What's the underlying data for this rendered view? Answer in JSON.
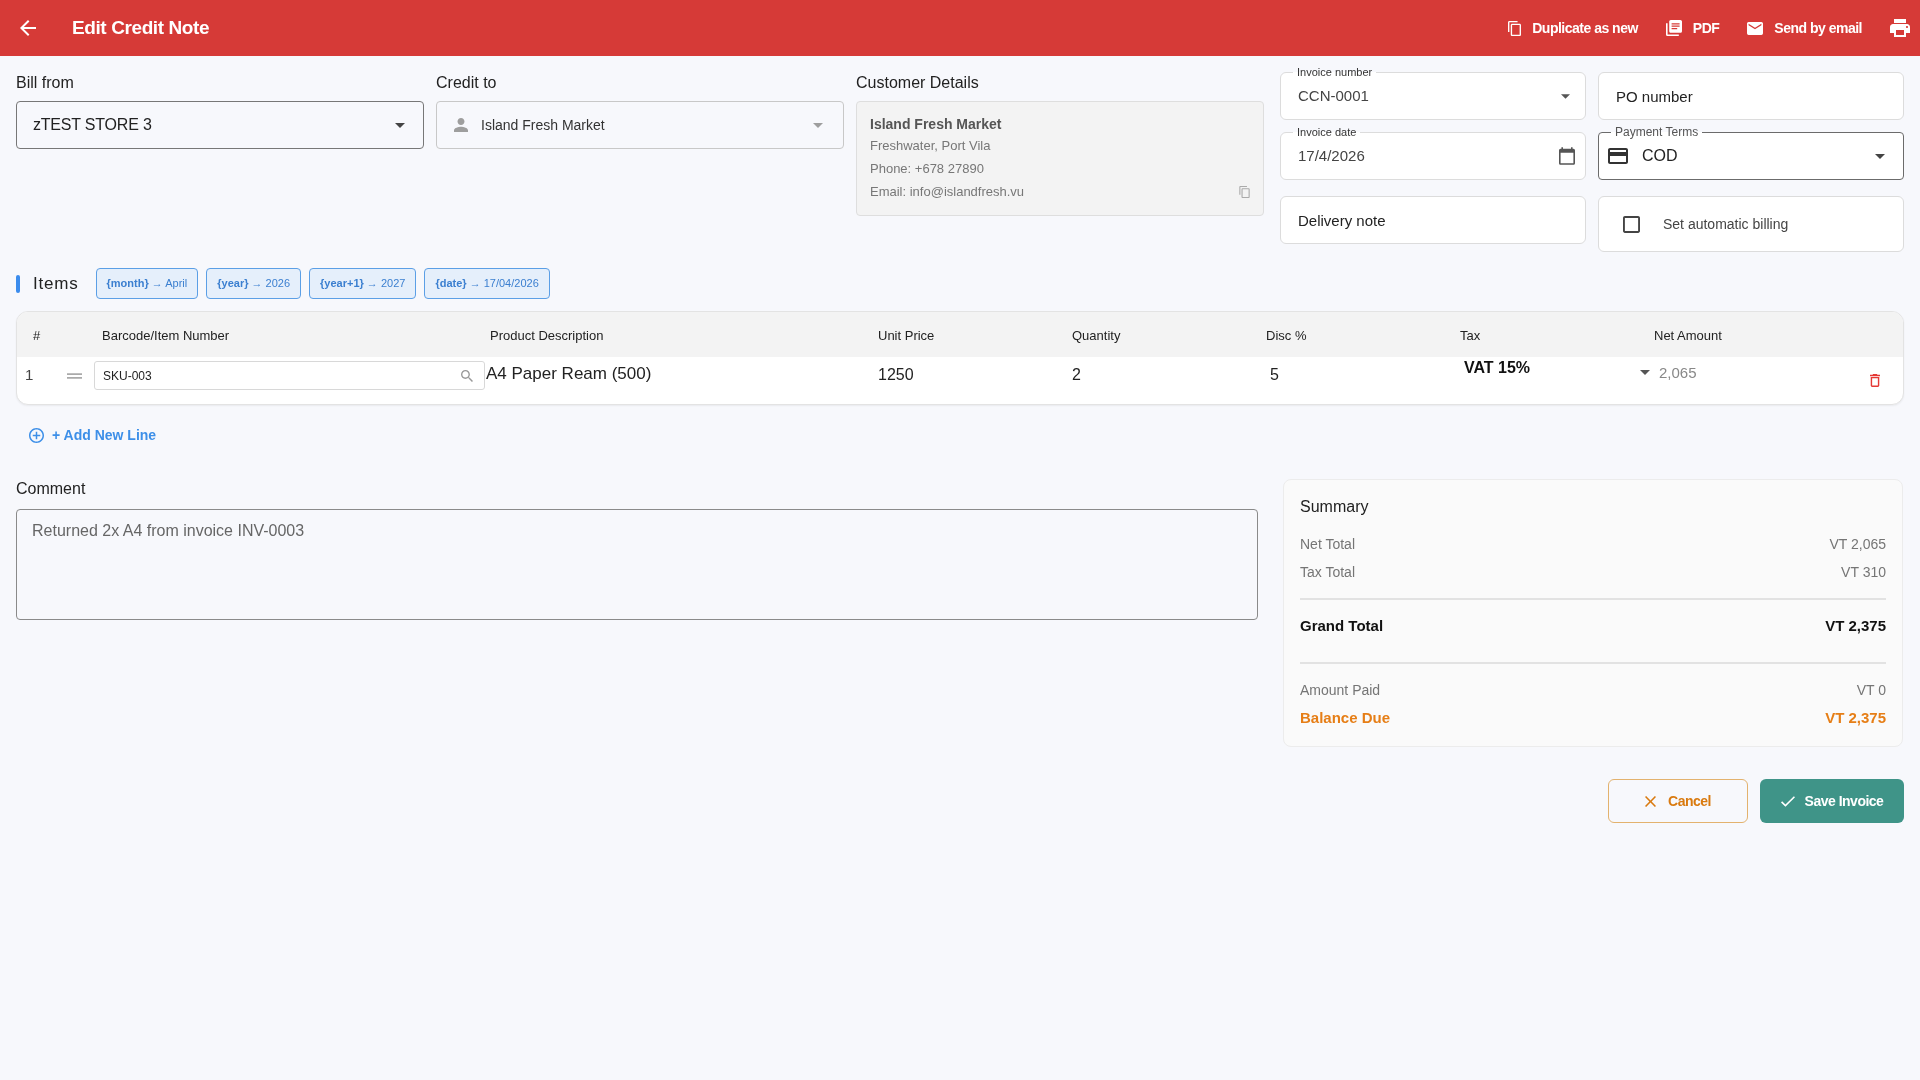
{
  "header": {
    "title": "Edit Credit Note",
    "actions": [
      {
        "kind": "duplicate",
        "label": "Duplicate as new"
      },
      {
        "kind": "pdf",
        "label": "PDF"
      },
      {
        "kind": "email",
        "label": "Send by email"
      },
      {
        "kind": "print"
      }
    ]
  },
  "bill_from": {
    "label": "Bill from",
    "value": "zTEST STORE 3"
  },
  "credit_to": {
    "label": "Credit to",
    "value": "Island Fresh Market"
  },
  "customer_details": {
    "heading": "Customer Details",
    "name": "Island Fresh Market",
    "lines": [
      "Freshwater, Port Vila",
      "Phone: +678 27890",
      "Email: info@islandfresh.vu"
    ]
  },
  "fields": [
    {
      "kind": "select",
      "label": "Invoice number",
      "value": "CCN-0001"
    },
    {
      "kind": "text",
      "placeholder": "PO number"
    },
    {
      "kind": "date",
      "label": "Invoice date",
      "value": "17/4/2026"
    },
    {
      "kind": "card_select",
      "label": "Payment Terms",
      "value": "COD"
    },
    {
      "kind": "text",
      "placeholder": "Delivery note"
    },
    {
      "kind": "checkbox",
      "label": "Set automatic billing",
      "checked": false
    }
  ],
  "items": {
    "title": "Items",
    "chips": [
      "**{month}** → April",
      "**{year}** → 2026",
      "**{year+1}** → 2027",
      "**{date}** → 17/04/2026"
    ],
    "columns": [
      "#",
      "Barcode/Item Number",
      "Product Description",
      "Unit Price",
      "Quantity",
      "Disc %",
      "Tax",
      "Net Amount"
    ],
    "rows": [
      {
        "number": "1",
        "barcode": "SKU-003",
        "description": "A4 Paper Ream (500)",
        "unit_price": "1250",
        "quantity": "2",
        "discount": "5",
        "tax": "VAT 15%",
        "net_amount": "2,065"
      }
    ],
    "add_line": "+ Add New Line"
  },
  "comment": {
    "label": "Comment",
    "value": "Returned 2x A4 from invoice INV-0003"
  },
  "summary": {
    "title": "Summary",
    "groups": [
      [
        {
          "kind": "minor",
          "label": "Net Total",
          "value": "VT 2,065"
        },
        {
          "kind": "minor",
          "label": "Tax Total",
          "value": "VT 310"
        }
      ],
      [
        {
          "kind": "total",
          "label": "Grand Total",
          "value": "VT 2,375"
        }
      ],
      [
        {
          "kind": "minor",
          "label": "Amount Paid",
          "value": "VT 0"
        },
        {
          "kind": "due",
          "label": "Balance Due",
          "value": "VT 2,375"
        }
      ]
    ]
  },
  "buttons": [
    {
      "kind": "cancel",
      "label": "Cancel"
    },
    {
      "kind": "save",
      "label": "Save Invoice"
    }
  ]
}
